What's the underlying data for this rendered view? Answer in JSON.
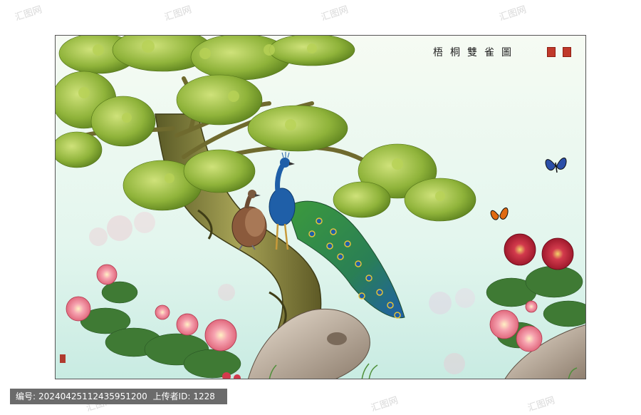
{
  "painting": {
    "title": "梧桐雙雀圖",
    "subjects": [
      "parasol tree",
      "peacock",
      "peahen",
      "peony flowers",
      "butterflies",
      "rocks"
    ]
  },
  "watermark": {
    "text": "汇图网"
  },
  "footer": {
    "id_label": "编号:",
    "id_value": "20240425112435951200",
    "uploader_label": "上传者ID:",
    "uploader_value": "1228"
  },
  "colors": {
    "sky_top": "#f4fbf2",
    "sky_bottom": "#cfeee6",
    "leaf": "#8fb33a",
    "leaf_dark": "#5d7f1f",
    "trunk": "#7f7a3a",
    "peony_red": "#c0223a",
    "peony_pink": "#f08a9a",
    "peacock_blue": "#1f5fa8",
    "peacock_green": "#2f8f3f"
  }
}
